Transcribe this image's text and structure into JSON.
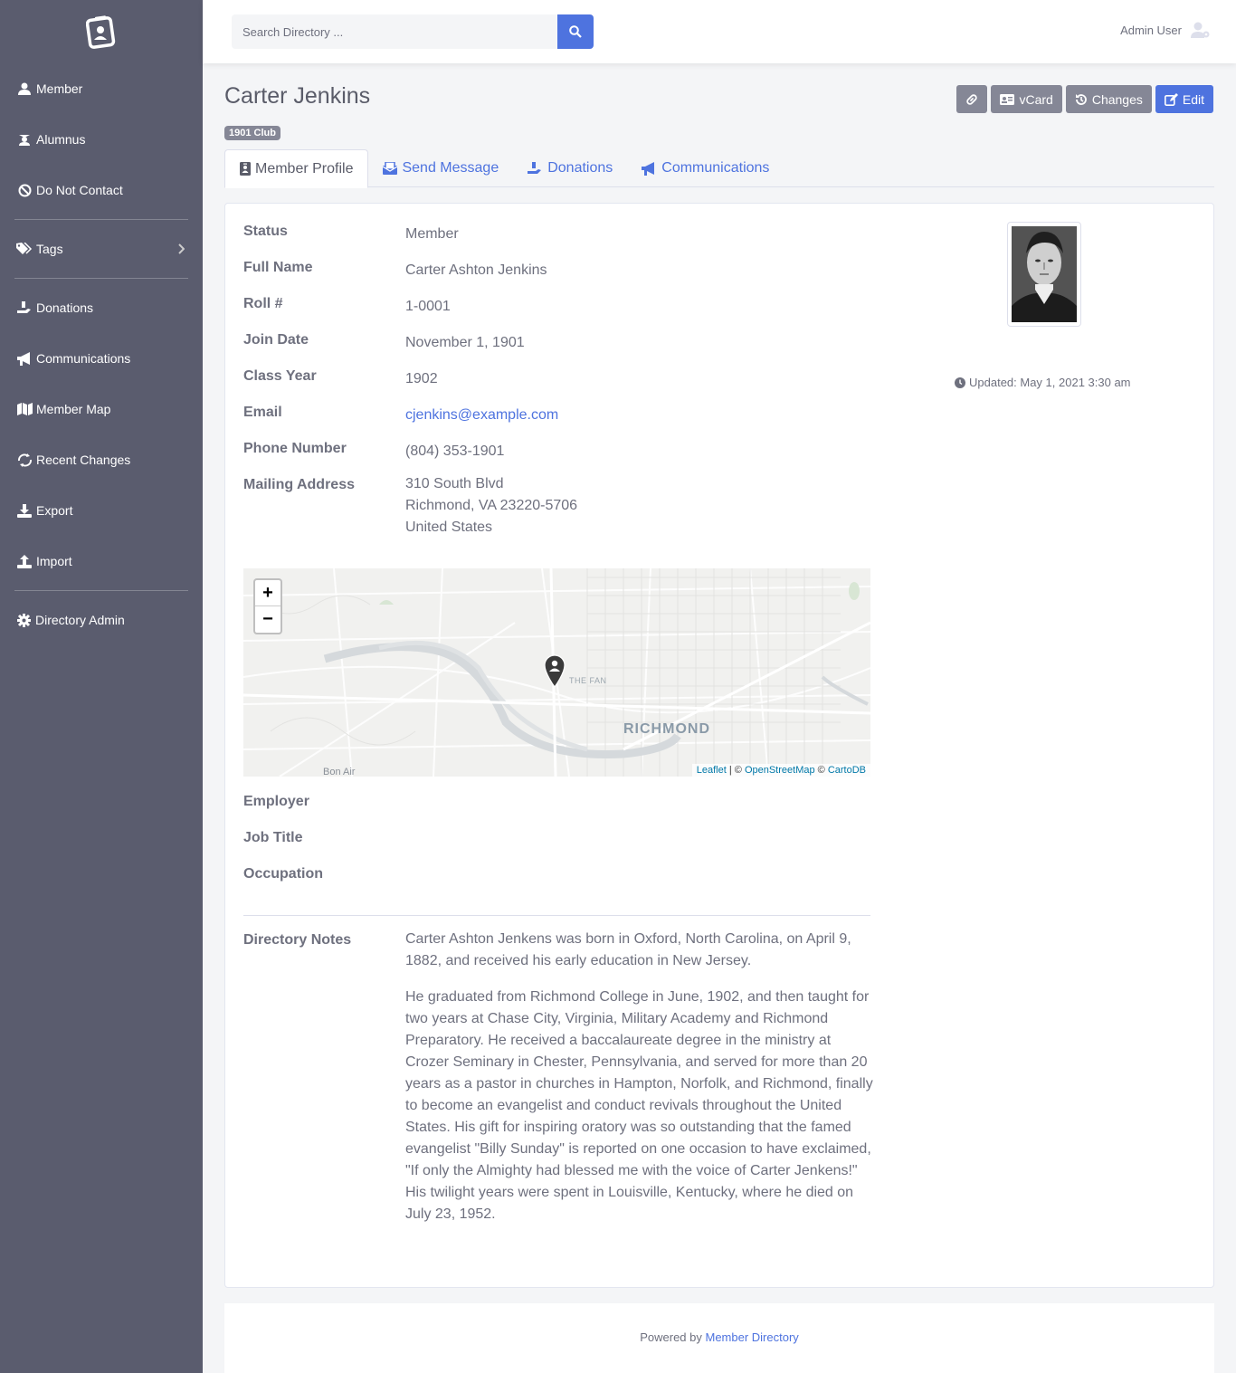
{
  "sidebar": {
    "items": [
      {
        "label": "Member",
        "icon": "user-icon"
      },
      {
        "label": "Alumnus",
        "icon": "graduate-icon"
      },
      {
        "label": "Do Not Contact",
        "icon": "ban-icon"
      },
      {
        "label": "Tags",
        "icon": "tags-icon"
      },
      {
        "label": "Donations",
        "icon": "donate-icon"
      },
      {
        "label": "Communications",
        "icon": "bullhorn-icon"
      },
      {
        "label": "Member Map",
        "icon": "map-icon"
      },
      {
        "label": "Recent Changes",
        "icon": "changes-icon"
      },
      {
        "label": "Export",
        "icon": "download-icon"
      },
      {
        "label": "Import",
        "icon": "upload-icon"
      },
      {
        "label": "Directory Admin",
        "icon": "gear-icon"
      }
    ]
  },
  "topbar": {
    "search_placeholder": "Search Directory ...",
    "user_name": "Admin User"
  },
  "page": {
    "title": "Carter Jenkins",
    "badge": "1901 Club"
  },
  "actions": {
    "vcard": "vCard",
    "changes": "Changes",
    "edit": "Edit"
  },
  "tabs": [
    {
      "label": "Member Profile",
      "active": true
    },
    {
      "label": "Send Message"
    },
    {
      "label": "Donations"
    },
    {
      "label": "Communications"
    }
  ],
  "profile": {
    "status_label": "Status",
    "status": "Member",
    "fullname_label": "Full Name",
    "fullname": "Carter Ashton Jenkins",
    "roll_label": "Roll #",
    "roll": "1-0001",
    "join_label": "Join Date",
    "join": "November 1, 1901",
    "class_label": "Class Year",
    "class": "1902",
    "email_label": "Email",
    "email": "cjenkins@example.com",
    "phone_label": "Phone Number",
    "phone": "(804) 353-1901",
    "address_label": "Mailing Address",
    "address_line1": "310 South Blvd",
    "address_line2": "Richmond, VA 23220-5706",
    "address_line3": "United States",
    "employer_label": "Employer",
    "jobtitle_label": "Job Title",
    "occupation_label": "Occupation",
    "notes_label": "Directory Notes",
    "notes_p1": "Carter Ashton Jenkens was born in Oxford, North Carolina, on April 9, 1882, and received his early education in New Jersey.",
    "notes_p2": "He graduated from Richmond College in June, 1902, and then taught for two years at Chase City, Virginia, Military Academy and Richmond Preparatory. He received a baccalaureate degree in the ministry at Crozer Seminary in Chester, Pennsylvania, and served for more than 20 years as a pastor in churches in Hampton, Norfolk, and Richmond, finally to become an evangelist and conduct revivals throughout the United States. His gift for inspiring oratory was so outstanding that the famed evangelist \"Billy Sunday\" is reported on one occasion to have exclaimed, \"If only the Almighty had blessed me with the voice of Carter Jenkens!\" His twilight years were spent in Louisville, Kentucky, where he died on July 23, 1952.",
    "updated": "Updated: May 1, 2021 3:30 am"
  },
  "map": {
    "zoom_in": "+",
    "zoom_out": "−",
    "label_city": "RICHMOND",
    "label_fan": "THE FAN",
    "label_bonair": "Bon Air",
    "attr_leaflet": "Leaflet",
    "attr_sep1": " | © ",
    "attr_osm": "OpenStreetMap",
    "attr_sep2": " © ",
    "attr_carto": "CartoDB"
  },
  "footer": {
    "prefix": "Powered by ",
    "link": "Member Directory"
  },
  "colors": {
    "sidebar": "#5a5c6e",
    "primary": "#4e73df",
    "secondary": "#858796"
  }
}
